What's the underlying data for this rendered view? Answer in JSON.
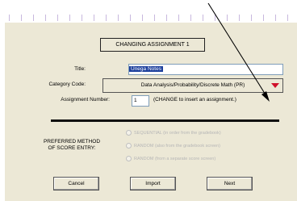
{
  "dialog": {
    "heading": "CHANGING ASSIGNMENT 1",
    "title_label": "Title:",
    "title_value": "Unega Notes",
    "category_label": "Category Code:",
    "category_value": "Data Analysis/Probability/Discrete Math (PR)",
    "assignment_number_label": "Assignment Number:",
    "assignment_number_value": "1",
    "assignment_hint": "(CHANGE to insert an assignment.)",
    "score_method_label_line1": "PREFERRED METHOD",
    "score_method_label_line2": "OF SCORE ENTRY:",
    "options": [
      "SEQUENTIAL (in order from the gradebook)",
      "RANDOM (also from the gradebook screen)",
      "RANDOM (from a separate score screen)"
    ],
    "buttons": {
      "cancel": "Cancel",
      "import": "Import",
      "next": "Next"
    }
  },
  "colors": {
    "panel_bg": "#ece8d6",
    "selection": "#1c3f9c",
    "dropdown_arrow": "#d0102a"
  }
}
